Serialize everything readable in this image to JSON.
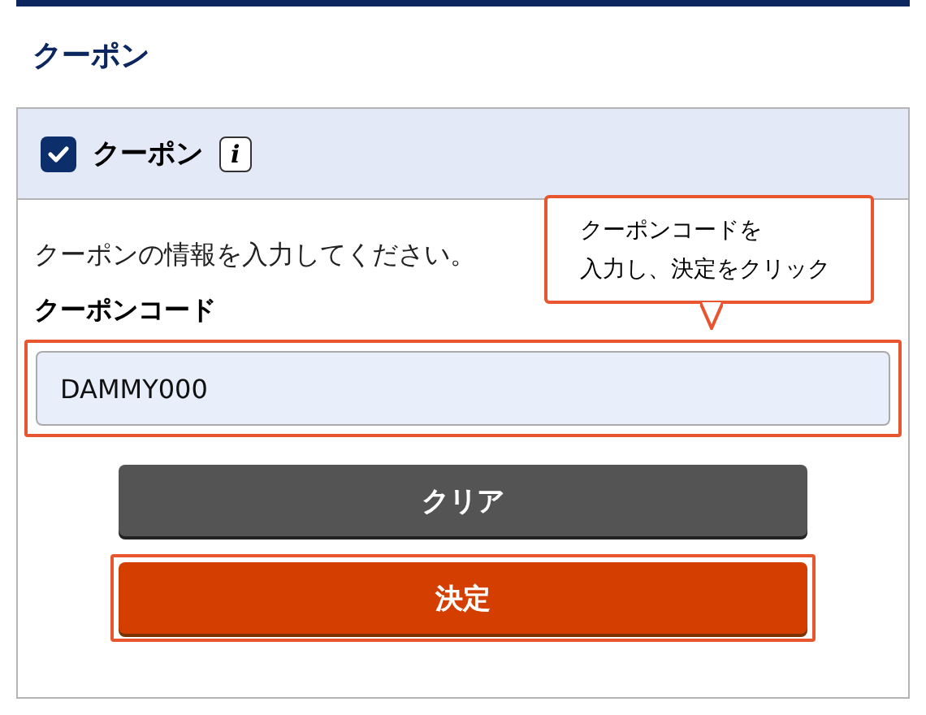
{
  "page_title": "クーポン",
  "panel": {
    "checkbox": {
      "label": "クーポン",
      "checked": true,
      "info_glyph": "i"
    },
    "instruction": "クーポンの情報を入力してください。",
    "field": {
      "label": "クーポンコード",
      "value": "DAMMY000",
      "highlighted": true
    },
    "callout": [
      "クーポンコードを",
      "入力し、決定をクリック"
    ],
    "buttons": [
      {
        "label": "クリア",
        "kind": "secondary",
        "highlighted": false
      },
      {
        "label": "決定",
        "kind": "primary",
        "highlighted": true
      }
    ]
  }
}
